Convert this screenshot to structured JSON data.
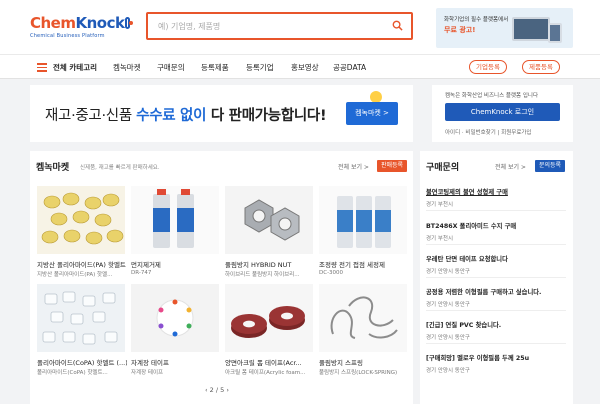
{
  "header": {
    "logo_main_1": "Chem",
    "logo_main_2": "Knock",
    "logo_sub": "Chemical Business Platform",
    "search_placeholder": "예) 기업명, 제품명",
    "ad": {
      "line1": "화학기업의 필수 플랫폼에서",
      "line2": "무료 광고!"
    }
  },
  "nav": {
    "category": "전체 카테고리",
    "items": [
      "켐녹마켓",
      "구매문의",
      "등록제품",
      "등록기업",
      "홍보영상",
      "공공DATA"
    ],
    "btn_company": "기업등록",
    "btn_product": "제품등록"
  },
  "promo": {
    "text_1": "재고·중고·신품 ",
    "text_hl": "수수료 없이",
    "text_2": " 다 판매가능합니다!",
    "button": "켐녹마켓 >"
  },
  "login": {
    "desc": "켐녹은 화학산업 비즈니스 플랫폼 입니다",
    "button": "ChemKnock 로그인",
    "links": "아이디 · 비밀번호찾기  |  회원무료가입"
  },
  "market": {
    "title": "켐녹마켓",
    "subtitle": "신제품, 재고를 빠르게 판매하세요.",
    "more": "전체 보기 >",
    "register": "판매등록",
    "pager": "‹   2 / 5   ›",
    "products": [
      {
        "name": "지방산 폴리아마이드(PA) 핫멜트",
        "sub": "지방산 폴리아마이드(PA) 핫멜..."
      },
      {
        "name": "먼지제거제",
        "sub": "DR-747"
      },
      {
        "name": "풀림방지 HYBRID NUT",
        "sub": "하이브리드 풀림방지 하이브리..."
      },
      {
        "name": "조정량 전기 접점 세정제",
        "sub": "DC-3000"
      },
      {
        "name": "폴리아마이드(CoPA) 핫멜트 (...)",
        "sub": "폴리아마이드(CoPA) 핫멜트..."
      },
      {
        "name": "자계장 테이프",
        "sub": "자계장 테이프"
      },
      {
        "name": "양면아크릴 폼 테이프(Acr...",
        "sub": "아크릴 폼 테이프(Acrylic foam..."
      },
      {
        "name": "풀림방지 스프링",
        "sub": "풀림방지 스프링(LOCK-SPRING)"
      }
    ]
  },
  "inquiry": {
    "title": "구매문의",
    "more": "전체 보기 >",
    "register": "문의등록",
    "items": [
      {
        "title": "불연코팅제의 불연 성형제 구매",
        "loc": "경기 부천시"
      },
      {
        "title": "BT2486X 폴리아미드 수지 구매",
        "loc": "경기 부천시"
      },
      {
        "title": "우레탄 단면 테이프 요청합니다",
        "loc": "경기 안양시 동안구"
      },
      {
        "title": "공정용 저렴한 이형필름 구매하고 싶습니다.",
        "loc": "경기 안양시 동안구"
      },
      {
        "title": "[긴급] 연질 PVC 찾습니다.",
        "loc": "경기 안양시 동안구"
      },
      {
        "title": "[구매희망] 멜로우 이형필름 두께 25u",
        "loc": "경기 안양시 동안구"
      }
    ]
  },
  "colors": {
    "accent": "#e8552b",
    "brand_blue": "#1f5ab8",
    "button_blue": "#1f6ad6"
  }
}
